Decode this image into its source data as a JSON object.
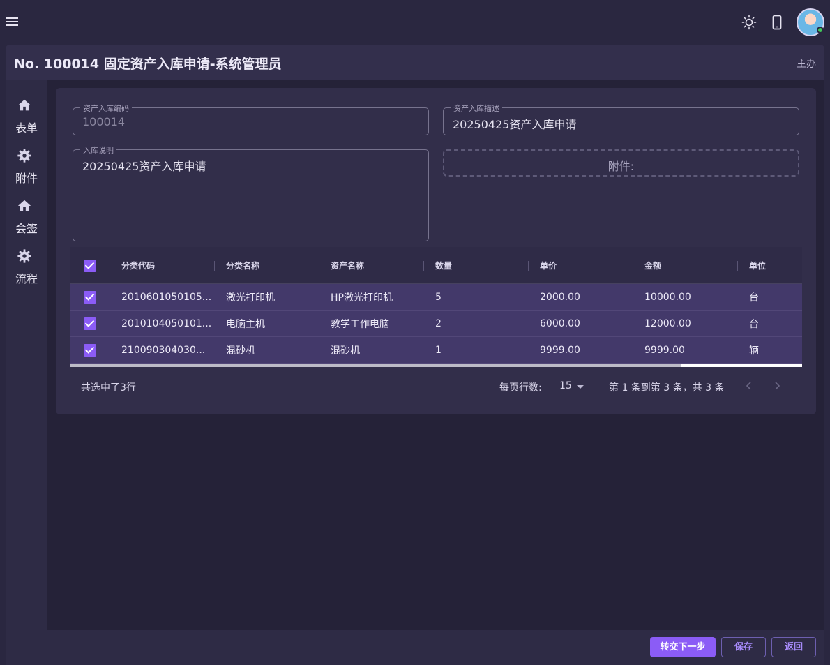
{
  "topbar": {
    "icons": [
      "menu-icon",
      "brightness-icon",
      "mobile-icon"
    ],
    "avatar_status_color": "#41c85a"
  },
  "page": {
    "title": "No. 100014 固定资产入库申请-系统管理员",
    "role": "主办"
  },
  "side_tabs": [
    {
      "label": "表单",
      "icon": "home-icon"
    },
    {
      "label": "附件",
      "icon": "gear-icon"
    },
    {
      "label": "会签",
      "icon": "home-icon"
    },
    {
      "label": "流程",
      "icon": "gear-icon"
    }
  ],
  "form": {
    "code": {
      "label": "资产入库编码",
      "value": "100014"
    },
    "desc": {
      "label": "资产入库描述",
      "value": "20250425资产入库申请"
    },
    "note": {
      "label": "入库说明",
      "value": "20250425资产入库申请"
    },
    "attachment_label": "附件:"
  },
  "table": {
    "columns": [
      "分类代码",
      "分类名称",
      "资产名称",
      "数量",
      "单价",
      "金额",
      "单位"
    ],
    "rows": [
      {
        "selected": true,
        "cells": [
          "2010601050105...",
          "激光打印机",
          "HP激光打印机",
          "5",
          "2000.00",
          "10000.00",
          "台"
        ]
      },
      {
        "selected": true,
        "cells": [
          "2010104050101...",
          "电脑主机",
          "教学工作电脑",
          "2",
          "6000.00",
          "12000.00",
          "台"
        ]
      },
      {
        "selected": true,
        "cells": [
          "210090304030...",
          "混砂机",
          "混砂机",
          "1",
          "9999.00",
          "9999.00",
          "辆"
        ]
      }
    ],
    "selected_text": "共选中了3行",
    "rows_per_page_label": "每页行数:",
    "rows_per_page": "15",
    "range_text": "第 1 条到第 3 条，共 3 条"
  },
  "actions": {
    "submit": "转交下一步",
    "save": "保存",
    "back": "返回"
  },
  "colors": {
    "accent": "#8b5cf6",
    "background": "#2a2740",
    "selected_row": "#43396a"
  }
}
